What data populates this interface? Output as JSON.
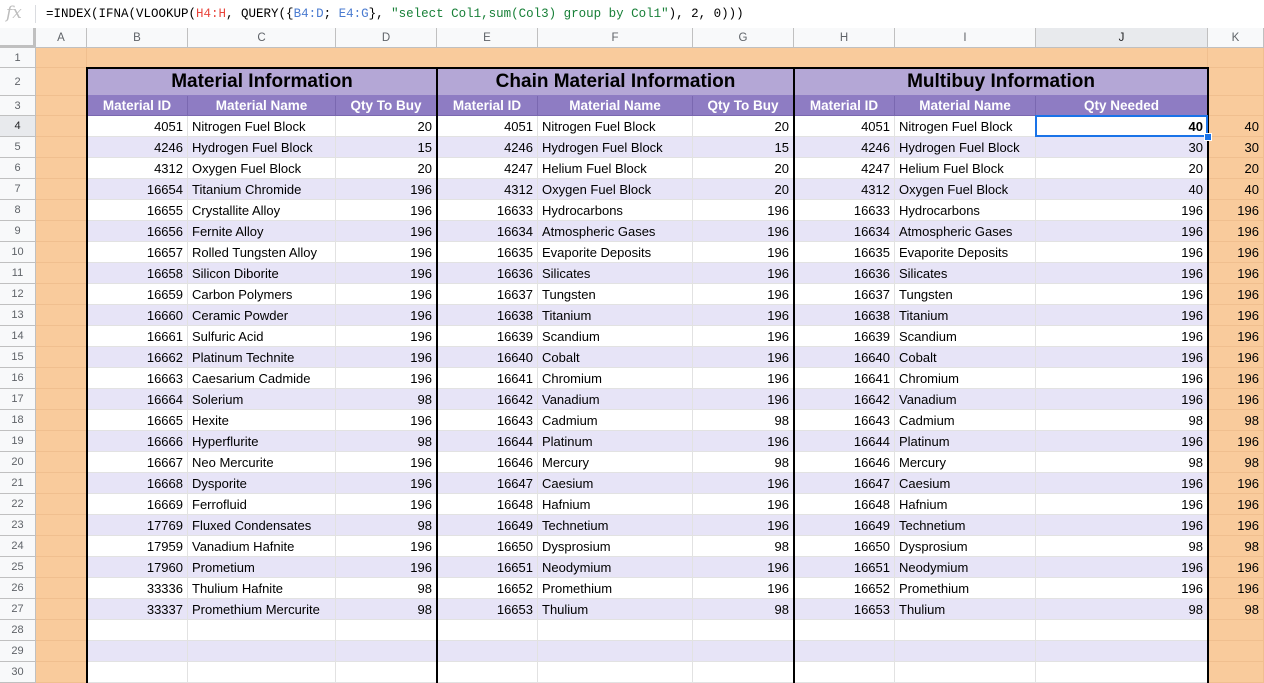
{
  "formula_bar": {
    "fx_label": "fx",
    "parts": [
      "=INDEX(IFNA(VLOOKUP(",
      "H4:H",
      ", QUERY({",
      "B4:D",
      "; ",
      "E4:G",
      "}, ",
      "\"select Col1,sum(Col3) group by Col1\"",
      "), 2, 0)))"
    ]
  },
  "columns": [
    "A",
    "B",
    "C",
    "D",
    "E",
    "F",
    "G",
    "H",
    "I",
    "J",
    "K"
  ],
  "selected_column": "J",
  "selected_row": "4",
  "rows": [
    "1",
    "2",
    "3",
    "4",
    "5",
    "6",
    "7",
    "8",
    "9",
    "10",
    "11",
    "12",
    "13",
    "14",
    "15",
    "16",
    "17",
    "18",
    "19",
    "20",
    "21",
    "22",
    "23",
    "24",
    "25",
    "26",
    "27",
    "28",
    "29",
    "30"
  ],
  "sections": {
    "material": {
      "title": "Material Information",
      "headers": [
        "Material ID",
        "Material Name",
        "Qty To Buy"
      ]
    },
    "chain": {
      "title": "Chain Material Information",
      "headers": [
        "Material ID",
        "Material Name",
        "Qty To Buy"
      ]
    },
    "multibuy": {
      "title": "Multibuy Information",
      "headers": [
        "Material ID",
        "Material Name",
        "Qty Needed"
      ]
    }
  },
  "data_rows": [
    {
      "b": "4051",
      "c": "Nitrogen Fuel Block",
      "d": "20",
      "e": "4051",
      "f": "Nitrogen Fuel Block",
      "g": "20",
      "h": "4051",
      "i": "Nitrogen Fuel Block",
      "j": "40",
      "k": "40"
    },
    {
      "b": "4246",
      "c": "Hydrogen Fuel Block",
      "d": "15",
      "e": "4246",
      "f": "Hydrogen Fuel Block",
      "g": "15",
      "h": "4246",
      "i": "Hydrogen Fuel Block",
      "j": "30",
      "k": "30"
    },
    {
      "b": "4312",
      "c": "Oxygen Fuel Block",
      "d": "20",
      "e": "4247",
      "f": "Helium Fuel Block",
      "g": "20",
      "h": "4247",
      "i": "Helium Fuel Block",
      "j": "20",
      "k": "20"
    },
    {
      "b": "16654",
      "c": "Titanium Chromide",
      "d": "196",
      "e": "4312",
      "f": "Oxygen Fuel Block",
      "g": "20",
      "h": "4312",
      "i": "Oxygen Fuel Block",
      "j": "40",
      "k": "40"
    },
    {
      "b": "16655",
      "c": "Crystallite Alloy",
      "d": "196",
      "e": "16633",
      "f": "Hydrocarbons",
      "g": "196",
      "h": "16633",
      "i": "Hydrocarbons",
      "j": "196",
      "k": "196"
    },
    {
      "b": "16656",
      "c": "Fernite Alloy",
      "d": "196",
      "e": "16634",
      "f": "Atmospheric Gases",
      "g": "196",
      "h": "16634",
      "i": "Atmospheric Gases",
      "j": "196",
      "k": "196"
    },
    {
      "b": "16657",
      "c": "Rolled Tungsten Alloy",
      "d": "196",
      "e": "16635",
      "f": "Evaporite Deposits",
      "g": "196",
      "h": "16635",
      "i": "Evaporite Deposits",
      "j": "196",
      "k": "196"
    },
    {
      "b": "16658",
      "c": "Silicon Diborite",
      "d": "196",
      "e": "16636",
      "f": "Silicates",
      "g": "196",
      "h": "16636",
      "i": "Silicates",
      "j": "196",
      "k": "196"
    },
    {
      "b": "16659",
      "c": "Carbon Polymers",
      "d": "196",
      "e": "16637",
      "f": "Tungsten",
      "g": "196",
      "h": "16637",
      "i": "Tungsten",
      "j": "196",
      "k": "196"
    },
    {
      "b": "16660",
      "c": "Ceramic Powder",
      "d": "196",
      "e": "16638",
      "f": "Titanium",
      "g": "196",
      "h": "16638",
      "i": "Titanium",
      "j": "196",
      "k": "196"
    },
    {
      "b": "16661",
      "c": "Sulfuric Acid",
      "d": "196",
      "e": "16639",
      "f": "Scandium",
      "g": "196",
      "h": "16639",
      "i": "Scandium",
      "j": "196",
      "k": "196"
    },
    {
      "b": "16662",
      "c": "Platinum Technite",
      "d": "196",
      "e": "16640",
      "f": "Cobalt",
      "g": "196",
      "h": "16640",
      "i": "Cobalt",
      "j": "196",
      "k": "196"
    },
    {
      "b": "16663",
      "c": "Caesarium Cadmide",
      "d": "196",
      "e": "16641",
      "f": "Chromium",
      "g": "196",
      "h": "16641",
      "i": "Chromium",
      "j": "196",
      "k": "196"
    },
    {
      "b": "16664",
      "c": "Solerium",
      "d": "98",
      "e": "16642",
      "f": "Vanadium",
      "g": "196",
      "h": "16642",
      "i": "Vanadium",
      "j": "196",
      "k": "196"
    },
    {
      "b": "16665",
      "c": "Hexite",
      "d": "196",
      "e": "16643",
      "f": "Cadmium",
      "g": "98",
      "h": "16643",
      "i": "Cadmium",
      "j": "98",
      "k": "98"
    },
    {
      "b": "16666",
      "c": "Hyperflurite",
      "d": "98",
      "e": "16644",
      "f": "Platinum",
      "g": "196",
      "h": "16644",
      "i": "Platinum",
      "j": "196",
      "k": "196"
    },
    {
      "b": "16667",
      "c": "Neo Mercurite",
      "d": "196",
      "e": "16646",
      "f": "Mercury",
      "g": "98",
      "h": "16646",
      "i": "Mercury",
      "j": "98",
      "k": "98"
    },
    {
      "b": "16668",
      "c": "Dysporite",
      "d": "196",
      "e": "16647",
      "f": "Caesium",
      "g": "196",
      "h": "16647",
      "i": "Caesium",
      "j": "196",
      "k": "196"
    },
    {
      "b": "16669",
      "c": "Ferrofluid",
      "d": "196",
      "e": "16648",
      "f": "Hafnium",
      "g": "196",
      "h": "16648",
      "i": "Hafnium",
      "j": "196",
      "k": "196"
    },
    {
      "b": "17769",
      "c": "Fluxed Condensates",
      "d": "98",
      "e": "16649",
      "f": "Technetium",
      "g": "196",
      "h": "16649",
      "i": "Technetium",
      "j": "196",
      "k": "196"
    },
    {
      "b": "17959",
      "c": "Vanadium Hafnite",
      "d": "196",
      "e": "16650",
      "f": "Dysprosium",
      "g": "98",
      "h": "16650",
      "i": "Dysprosium",
      "j": "98",
      "k": "98"
    },
    {
      "b": "17960",
      "c": "Prometium",
      "d": "196",
      "e": "16651",
      "f": "Neodymium",
      "g": "196",
      "h": "16651",
      "i": "Neodymium",
      "j": "196",
      "k": "196"
    },
    {
      "b": "33336",
      "c": "Thulium Hafnite",
      "d": "98",
      "e": "16652",
      "f": "Promethium",
      "g": "196",
      "h": "16652",
      "i": "Promethium",
      "j": "196",
      "k": "196"
    },
    {
      "b": "33337",
      "c": "Promethium Mercurite",
      "d": "98",
      "e": "16653",
      "f": "Thulium",
      "g": "98",
      "h": "16653",
      "i": "Thulium",
      "j": "98",
      "k": "98"
    }
  ],
  "colors": {
    "peach": "#f9cb9c",
    "title_band": "#b4a7d6",
    "header_band": "#8e7cc3",
    "alt_row": "#e7e4f7",
    "selection": "#1a73e8"
  }
}
